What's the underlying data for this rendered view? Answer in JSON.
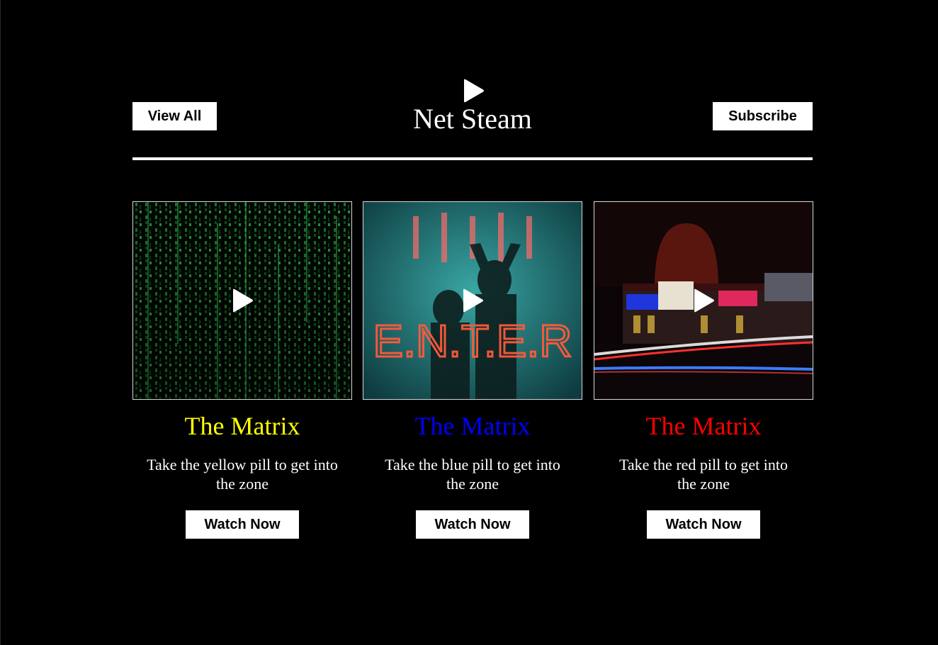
{
  "header": {
    "view_all_label": "View All",
    "brand_title": "Net Steam",
    "subscribe_label": "Subscribe"
  },
  "cards": [
    {
      "title": "The Matrix",
      "title_color": "#ffff00",
      "description": "Take the yellow pill to get into the zone",
      "button_label": "Watch Now",
      "thumbnail_icon": "play-icon"
    },
    {
      "title": "The Matrix",
      "title_color": "#0000ff",
      "description": "Take the blue pill to get into the zone",
      "button_label": "Watch Now",
      "thumbnail_icon": "play-icon"
    },
    {
      "title": "The Matrix",
      "title_color": "#ff0000",
      "description": "Take the red pill to get into the zone",
      "button_label": "Watch Now",
      "thumbnail_icon": "play-icon"
    }
  ],
  "colors": {
    "background": "#000000",
    "text": "#ffffff",
    "button_bg": "#ffffff",
    "button_text": "#000000"
  }
}
